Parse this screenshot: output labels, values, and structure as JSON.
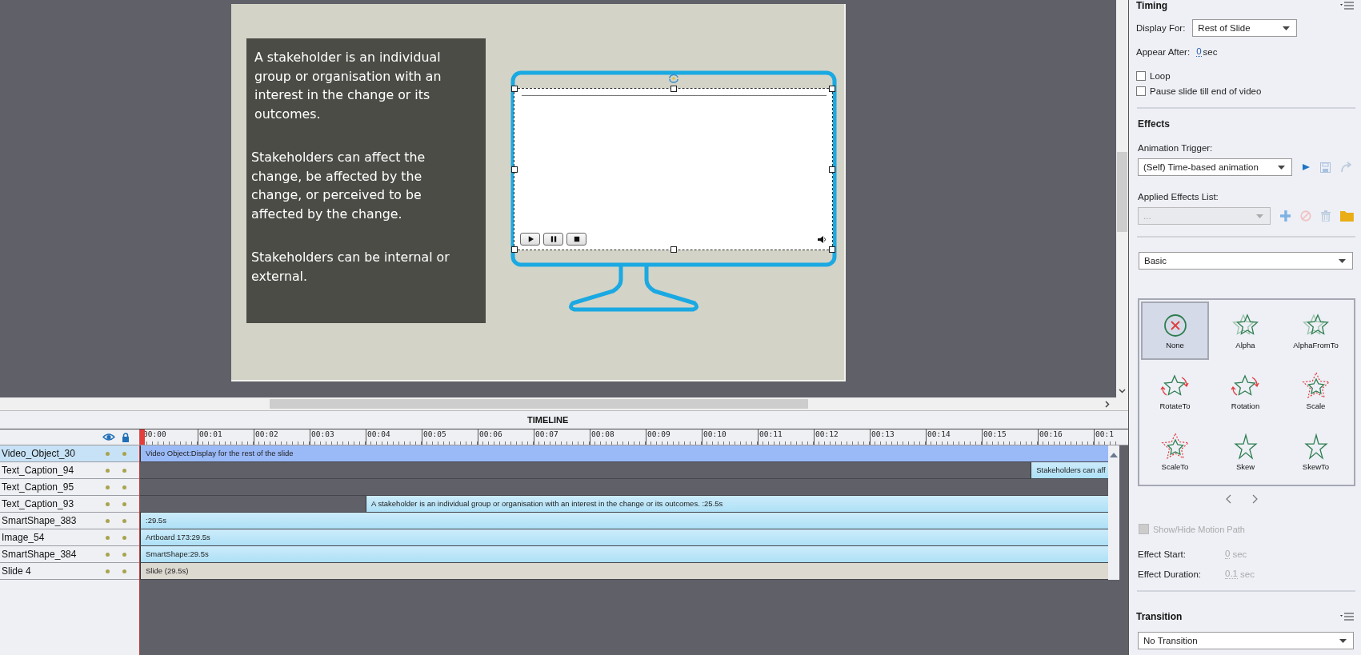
{
  "slide": {
    "paragraphs": [
      "A stakeholder is an individual group or organisation with an interest in the change or its outcomes.",
      "Stakeholders can affect the change, be affected by the change, or perceived to be affected by the change.",
      "Stakeholders can be internal or external."
    ],
    "video": {
      "controls": [
        {
          "kind": "play"
        },
        {
          "kind": "pause"
        },
        {
          "kind": "stop"
        }
      ]
    }
  },
  "timeline": {
    "title": "TIMELINE",
    "ticks": [
      "00:00",
      "00:01",
      "00:02",
      "00:03",
      "00:04",
      "00:05",
      "00:06",
      "00:07",
      "00:08",
      "00:09",
      "00:10",
      "00:11",
      "00:12",
      "00:13",
      "00:14",
      "00:15",
      "00:16",
      "00:1"
    ],
    "rows": [
      {
        "name": "Video_Object_30",
        "selected": true,
        "bar": {
          "kind": "video",
          "level": 1,
          "label": "Video Object:Display for the rest of the slide"
        }
      },
      {
        "name": "Text_Caption_94",
        "selected": false,
        "bar": {
          "kind": "item",
          "level": 0.08,
          "label": "Stakeholders can aff"
        }
      },
      {
        "name": "Text_Caption_95",
        "selected": false
      },
      {
        "name": "Text_Caption_93",
        "selected": false,
        "bar": {
          "kind": "item",
          "level": 0.767,
          "label": "A stakeholder is an individual group or organisation with an interest in the change or its outcomes. :25.5s"
        }
      },
      {
        "name": "SmartShape_383",
        "selected": false,
        "bar": {
          "kind": "item",
          "level": 1,
          "label": ":29.5s"
        }
      },
      {
        "name": "Image_54",
        "selected": false,
        "bar": {
          "kind": "item",
          "level": 1,
          "label": "Artboard 173:29.5s"
        }
      },
      {
        "name": "SmartShape_384",
        "selected": false,
        "bar": {
          "kind": "item",
          "level": 1,
          "label": "SmartShape:29.5s"
        }
      },
      {
        "name": "Slide 4",
        "selected": false,
        "bar": {
          "kind": "slide",
          "level": 1,
          "label": "Slide (29.5s)"
        }
      }
    ]
  },
  "properties": {
    "timing": {
      "title": "Timing",
      "display_for": {
        "label": "Display For:",
        "value": "Rest of Slide"
      },
      "appear_after": {
        "label": "Appear After:",
        "value": "0",
        "unit": "sec"
      },
      "checkboxes": [
        {
          "label": "Loop",
          "checked": false
        },
        {
          "label": "Pause slide till end of video",
          "checked": false
        }
      ]
    },
    "effects": {
      "title": "Effects",
      "trigger_label": "Animation Trigger:",
      "trigger": "(Self) Time-based animation",
      "applied_label": "Applied Effects List:",
      "applied": {
        "value": "...",
        "disabled": true
      },
      "category": "Basic",
      "items": [
        {
          "label": "None",
          "kind": "none",
          "selected": true
        },
        {
          "label": "Alpha",
          "kind": "alpha",
          "selected": false
        },
        {
          "label": "AlphaFromTo",
          "kind": "alpha",
          "selected": false
        },
        {
          "label": "RotateTo",
          "kind": "rotate",
          "selected": false
        },
        {
          "label": "Rotation",
          "kind": "rotate",
          "selected": false
        },
        {
          "label": "Scale",
          "kind": "scale",
          "selected": false
        },
        {
          "label": "ScaleTo",
          "kind": "scale",
          "selected": false
        },
        {
          "label": "Skew",
          "kind": "skew",
          "selected": false
        },
        {
          "label": "SkewTo",
          "kind": "skew",
          "selected": false
        }
      ],
      "motion_path": {
        "label": "Show/Hide Motion Path",
        "checked": false,
        "disabled": true
      },
      "effect_start": {
        "label": "Effect Start:",
        "value": "0",
        "unit": "sec",
        "disabled": true
      },
      "effect_duration": {
        "label": "Effect Duration:",
        "value": "0.1",
        "unit": "sec",
        "disabled": true
      }
    },
    "transition": {
      "title": "Transition",
      "value": "No Transition"
    }
  }
}
